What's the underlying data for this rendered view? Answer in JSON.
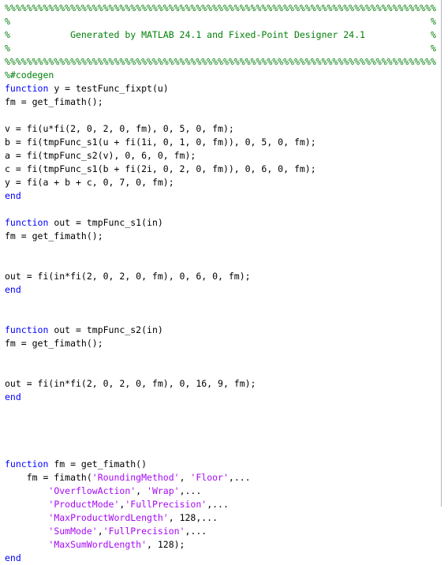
{
  "editor": {
    "language": "matlab",
    "background_color": "#ffffff",
    "ruler_color": "#b4b4b4",
    "colors": {
      "comment": "#028009",
      "keyword": "#0000ff",
      "string": "#a709f5",
      "plain": "#000000"
    }
  },
  "header_banner": {
    "rule_line": "%%%%%%%%%%%%%%%%%%%%%%%%%%%%%%%%%%%%%%%%%%%%%%%%%%%%%%%%%%%%%%%%%%%%%%%%%%%%%%%",
    "generated_by_text": "Generated by MATLAB 24.1 and Fixed-Point Designer 24.1",
    "matlab_version": "24.1",
    "fixed_point_designer_version": "24.1",
    "codegen_directive": "%#codegen"
  },
  "code_lines": [
    {
      "n": 1,
      "segments": [
        {
          "t": "cmt",
          "s": "%%%%%%%%%%%%%%%%%%%%%%%%%%%%%%%%%%%%%%%%%%%%%%%%%%%%%%%%%%%%%%%%%%%%%%%%%%%%%%%"
        }
      ]
    },
    {
      "n": 2,
      "segments": [
        {
          "t": "cmt",
          "s": "%                                                                             %"
        }
      ]
    },
    {
      "n": 3,
      "segments": [
        {
          "t": "cmt",
          "s": "%           Generated by MATLAB 24.1 and Fixed-Point Designer 24.1            %"
        }
      ]
    },
    {
      "n": 4,
      "segments": [
        {
          "t": "cmt",
          "s": "%                                                                             %"
        }
      ]
    },
    {
      "n": 5,
      "segments": [
        {
          "t": "cmt",
          "s": "%%%%%%%%%%%%%%%%%%%%%%%%%%%%%%%%%%%%%%%%%%%%%%%%%%%%%%%%%%%%%%%%%%%%%%%%%%%%%%%"
        }
      ]
    },
    {
      "n": 6,
      "segments": [
        {
          "t": "cmt",
          "s": "%#codegen"
        }
      ]
    },
    {
      "n": 7,
      "segments": [
        {
          "t": "kw",
          "s": "function"
        },
        {
          "t": "pln",
          "s": " y = testFunc_fixpt(u)"
        }
      ]
    },
    {
      "n": 8,
      "segments": [
        {
          "t": "pln",
          "s": "fm = get_fimath();"
        }
      ]
    },
    {
      "n": 9,
      "segments": [
        {
          "t": "pln",
          "s": ""
        }
      ]
    },
    {
      "n": 10,
      "segments": [
        {
          "t": "pln",
          "s": "v = fi(u*fi(2, 0, 2, 0, fm), 0, 5, 0, fm);"
        }
      ]
    },
    {
      "n": 11,
      "segments": [
        {
          "t": "pln",
          "s": "b = fi(tmpFunc_s1(u + fi(1i, 0, 1, 0, fm)), 0, 5, 0, fm);"
        }
      ]
    },
    {
      "n": 12,
      "segments": [
        {
          "t": "pln",
          "s": "a = fi(tmpFunc_s2(v), 0, 6, 0, fm);"
        }
      ]
    },
    {
      "n": 13,
      "segments": [
        {
          "t": "pln",
          "s": "c = fi(tmpFunc_s1(b + fi(2i, 0, 2, 0, fm)), 0, 6, 0, fm);"
        }
      ]
    },
    {
      "n": 14,
      "segments": [
        {
          "t": "pln",
          "s": "y = fi(a + b + c, 0, 7, 0, fm);"
        }
      ]
    },
    {
      "n": 15,
      "segments": [
        {
          "t": "kw",
          "s": "end"
        }
      ]
    },
    {
      "n": 16,
      "segments": [
        {
          "t": "pln",
          "s": ""
        }
      ]
    },
    {
      "n": 17,
      "segments": [
        {
          "t": "kw",
          "s": "function"
        },
        {
          "t": "pln",
          "s": " out = tmpFunc_s1(in)"
        }
      ]
    },
    {
      "n": 18,
      "segments": [
        {
          "t": "pln",
          "s": "fm = get_fimath();"
        }
      ]
    },
    {
      "n": 19,
      "segments": [
        {
          "t": "pln",
          "s": ""
        }
      ]
    },
    {
      "n": 20,
      "segments": [
        {
          "t": "pln",
          "s": ""
        }
      ]
    },
    {
      "n": 21,
      "segments": [
        {
          "t": "pln",
          "s": "out = fi(in*fi(2, 0, 2, 0, fm), 0, 6, 0, fm);"
        }
      ]
    },
    {
      "n": 22,
      "segments": [
        {
          "t": "kw",
          "s": "end"
        }
      ]
    },
    {
      "n": 23,
      "segments": [
        {
          "t": "pln",
          "s": ""
        }
      ]
    },
    {
      "n": 24,
      "segments": [
        {
          "t": "pln",
          "s": ""
        }
      ]
    },
    {
      "n": 25,
      "segments": [
        {
          "t": "kw",
          "s": "function"
        },
        {
          "t": "pln",
          "s": " out = tmpFunc_s2(in)"
        }
      ]
    },
    {
      "n": 26,
      "segments": [
        {
          "t": "pln",
          "s": "fm = get_fimath();"
        }
      ]
    },
    {
      "n": 27,
      "segments": [
        {
          "t": "pln",
          "s": ""
        }
      ]
    },
    {
      "n": 28,
      "segments": [
        {
          "t": "pln",
          "s": ""
        }
      ]
    },
    {
      "n": 29,
      "segments": [
        {
          "t": "pln",
          "s": "out = fi(in*fi(2, 0, 2, 0, fm), 0, 16, 9, fm);"
        }
      ]
    },
    {
      "n": 30,
      "segments": [
        {
          "t": "kw",
          "s": "end"
        }
      ]
    },
    {
      "n": 31,
      "segments": [
        {
          "t": "pln",
          "s": ""
        }
      ]
    },
    {
      "n": 32,
      "segments": [
        {
          "t": "pln",
          "s": ""
        }
      ]
    },
    {
      "n": 33,
      "segments": [
        {
          "t": "pln",
          "s": ""
        }
      ]
    },
    {
      "n": 34,
      "segments": [
        {
          "t": "pln",
          "s": ""
        }
      ]
    },
    {
      "n": 35,
      "segments": [
        {
          "t": "kw",
          "s": "function"
        },
        {
          "t": "pln",
          "s": " fm = get_fimath()"
        }
      ]
    },
    {
      "n": 36,
      "segments": [
        {
          "t": "pln",
          "s": "    fm = fimath("
        },
        {
          "t": "str",
          "s": "'RoundingMethod'"
        },
        {
          "t": "pln",
          "s": ", "
        },
        {
          "t": "str",
          "s": "'Floor'"
        },
        {
          "t": "pln",
          "s": ",..."
        }
      ]
    },
    {
      "n": 37,
      "segments": [
        {
          "t": "pln",
          "s": "        "
        },
        {
          "t": "str",
          "s": "'OverflowAction'"
        },
        {
          "t": "pln",
          "s": ", "
        },
        {
          "t": "str",
          "s": "'Wrap'"
        },
        {
          "t": "pln",
          "s": ",..."
        }
      ]
    },
    {
      "n": 38,
      "segments": [
        {
          "t": "pln",
          "s": "        "
        },
        {
          "t": "str",
          "s": "'ProductMode'"
        },
        {
          "t": "pln",
          "s": ","
        },
        {
          "t": "str",
          "s": "'FullPrecision'"
        },
        {
          "t": "pln",
          "s": ",..."
        }
      ]
    },
    {
      "n": 39,
      "segments": [
        {
          "t": "pln",
          "s": "        "
        },
        {
          "t": "str",
          "s": "'MaxProductWordLength'"
        },
        {
          "t": "pln",
          "s": ", 128,..."
        }
      ]
    },
    {
      "n": 40,
      "segments": [
        {
          "t": "pln",
          "s": "        "
        },
        {
          "t": "str",
          "s": "'SumMode'"
        },
        {
          "t": "pln",
          "s": ","
        },
        {
          "t": "str",
          "s": "'FullPrecision'"
        },
        {
          "t": "pln",
          "s": ",..."
        }
      ]
    },
    {
      "n": 41,
      "segments": [
        {
          "t": "pln",
          "s": "        "
        },
        {
          "t": "str",
          "s": "'MaxSumWordLength'"
        },
        {
          "t": "pln",
          "s": ", 128);"
        }
      ]
    },
    {
      "n": 42,
      "segments": [
        {
          "t": "kw",
          "s": "end"
        }
      ]
    }
  ]
}
